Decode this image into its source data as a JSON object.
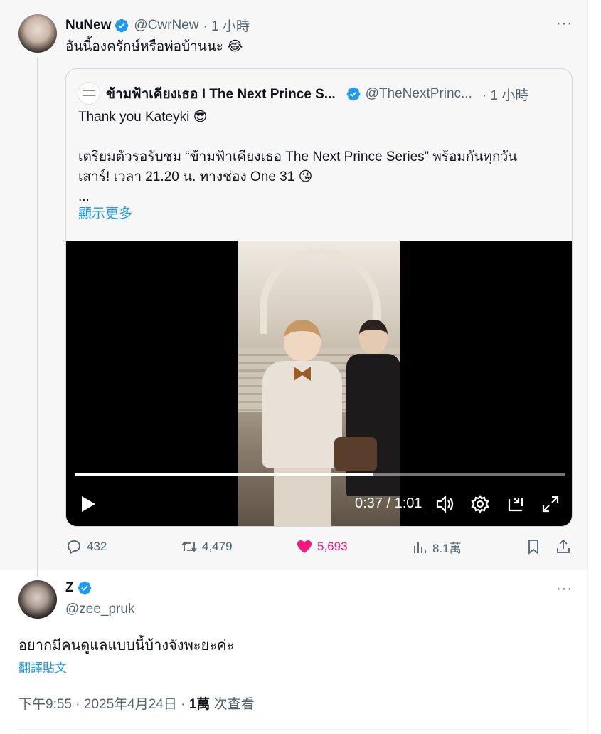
{
  "colors": {
    "accent": "#1d9bf0",
    "like": "#f91880",
    "muted": "#536471",
    "text": "#0f1419"
  },
  "parent": {
    "name": "NuNew",
    "handle": "@CwrNew",
    "time": "· 1 小時",
    "text": "อันนี้องครักษ์หรือพ่อบ้านนะ 😂",
    "more": "···"
  },
  "quote": {
    "name": "ข้ามฟ้าเคียงเธอ I The Next Prince S...",
    "handle": "@TheNextPrinc...",
    "time": "· 1 小時",
    "line1": "Thank you Kateyki 😎",
    "line2": "เตรียมตัวรอรับชม “ข้ามฟ้าเคียงเธอ The Next Prince Series” พร้อมกันทุกวัน",
    "line3": "เสาร์! เวลา 21.20 น. ทางช่อง One 31 😘",
    "ellipsis": "...",
    "show_more": "顯示更多"
  },
  "video": {
    "time": "0:37 / 1:01",
    "progress": 0.61
  },
  "actions": {
    "replies": "432",
    "reposts": "4,479",
    "likes": "5,693",
    "views": "8.1萬"
  },
  "reply": {
    "name": "Z",
    "handle": "@zee_pruk",
    "text": "อยากมีคนดูแลแบบนี้บ้างจังพะยะค่ะ",
    "translate": "翻譯貼文",
    "timestamp": "下午9:55 · 2025年4月24日 · ",
    "views_count": "1萬",
    "views_label": " 次查看",
    "more": "···"
  }
}
